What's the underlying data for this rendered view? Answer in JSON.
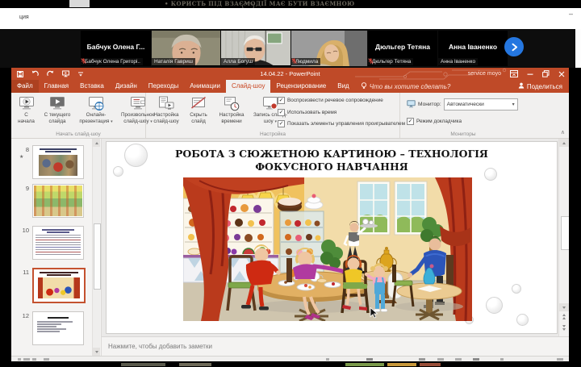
{
  "frame": {
    "behind_text": "• КОРИСТЬ ПІД ВЗАЄМОДІЇ МАЄ БУТИ ВЗАЄМНОЮ",
    "app_bar_title": "ция"
  },
  "meeting": {
    "participants": [
      {
        "center_name": "Бабчук Олена Г...",
        "label": "Бабчук Олена Григорі..",
        "muted": true,
        "video": null
      },
      {
        "center_name": null,
        "label": "Наталія Гавриш",
        "muted": false,
        "video": "natalia"
      },
      {
        "center_name": null,
        "label": "Алла Богуш",
        "muted": false,
        "video": "alla"
      },
      {
        "center_name": null,
        "label": "Людмила",
        "muted": true,
        "video": "lyudmila"
      },
      {
        "center_name": "Дюльгер Тетяна",
        "label": "Дюльгер Тетяна",
        "muted": true,
        "video": null
      },
      {
        "center_name": "Анна Іваненко",
        "label": "Анна Іваненко",
        "muted": false,
        "video": null
      }
    ],
    "next_button_icon": "chevron-right-icon",
    "muted_icon": "mic-muted-icon"
  },
  "powerpoint": {
    "accent_color": "#BF4A28",
    "titlebar": {
      "title": "14.04.22 - PowerPoint",
      "account": "service moyo",
      "qat_icons": [
        "save-icon",
        "undo-icon",
        "redo-icon",
        "slideshow-icon",
        "customize-qat-icon"
      ],
      "window_icons": [
        "ribbon-display-options-icon",
        "minimize-icon",
        "restore-icon",
        "close-icon"
      ]
    },
    "tabs": [
      {
        "label": "Файл",
        "file": true
      },
      {
        "label": "Главная"
      },
      {
        "label": "Вставка"
      },
      {
        "label": "Дизайн"
      },
      {
        "label": "Переходы"
      },
      {
        "label": "Анимации"
      },
      {
        "label": "Слайд-шоу",
        "active": true
      },
      {
        "label": "Рецензирование"
      },
      {
        "label": "Вид"
      }
    ],
    "tell_me": "Что вы хотите сделать?",
    "tell_me_icon": "lightbulb-icon",
    "share_label": "Поделиться",
    "share_icon": "person-icon",
    "ribbon": {
      "start_group": {
        "label": "Начать слайд-шоу",
        "buttons": [
          {
            "label": "С начала",
            "icon": "start-from-beginning-icon"
          },
          {
            "label": "С текущего слайда",
            "icon": "from-current-slide-icon"
          },
          {
            "label": "Онлайн-презентация",
            "icon": "online-presentation-icon",
            "menu": true
          },
          {
            "label": "Произвольное слайд-шоу",
            "icon": "custom-slideshow-icon",
            "menu": true
          }
        ]
      },
      "setup_group": {
        "label": "Настройка",
        "buttons": [
          {
            "label": "Настройка слайд-шоу",
            "icon": "setup-slideshow-icon"
          },
          {
            "label": "Скрыть слайд",
            "icon": "hide-slide-icon"
          },
          {
            "label": "Настройка времени",
            "icon": "rehearse-timings-icon"
          },
          {
            "label": "Запись слайд-шоу",
            "icon": "record-slideshow-icon",
            "menu": true
          }
        ],
        "checkboxes": [
          {
            "label": "Воспроизвести речевое сопровождение",
            "checked": true
          },
          {
            "label": "Использовать время",
            "checked": true
          },
          {
            "label": "Показать элементы управления проигрывателем",
            "checked": true
          }
        ]
      },
      "monitors_group": {
        "label": "Мониторы",
        "monitor_label": "Монитор:",
        "monitor_icon": "monitor-small-icon",
        "monitor_value": "Автоматически",
        "presenter_checkbox": {
          "label": "Режим докладчика",
          "checked": true
        }
      }
    },
    "thumbnails": [
      {
        "number": "8",
        "starred": true,
        "style": "photo",
        "selected": false
      },
      {
        "number": "9",
        "starred": false,
        "style": "market",
        "selected": false
      },
      {
        "number": "10",
        "starred": false,
        "style": "dense-text",
        "selected": false
      },
      {
        "number": "11",
        "starred": false,
        "style": "cafe",
        "selected": true
      },
      {
        "number": "12",
        "starred": false,
        "style": "bullet-list",
        "selected": false
      }
    ],
    "slide": {
      "title": "РОБОТА З СЮЖЕТНОЮ КАРТИНОЮ – ТЕХНОЛОГІЯ ФОКУСНОГО НАВЧАННЯ",
      "illustration": "cafe-family-scene-illustration"
    },
    "notes_placeholder": "Нажмите, чтобы добавить заметки"
  }
}
